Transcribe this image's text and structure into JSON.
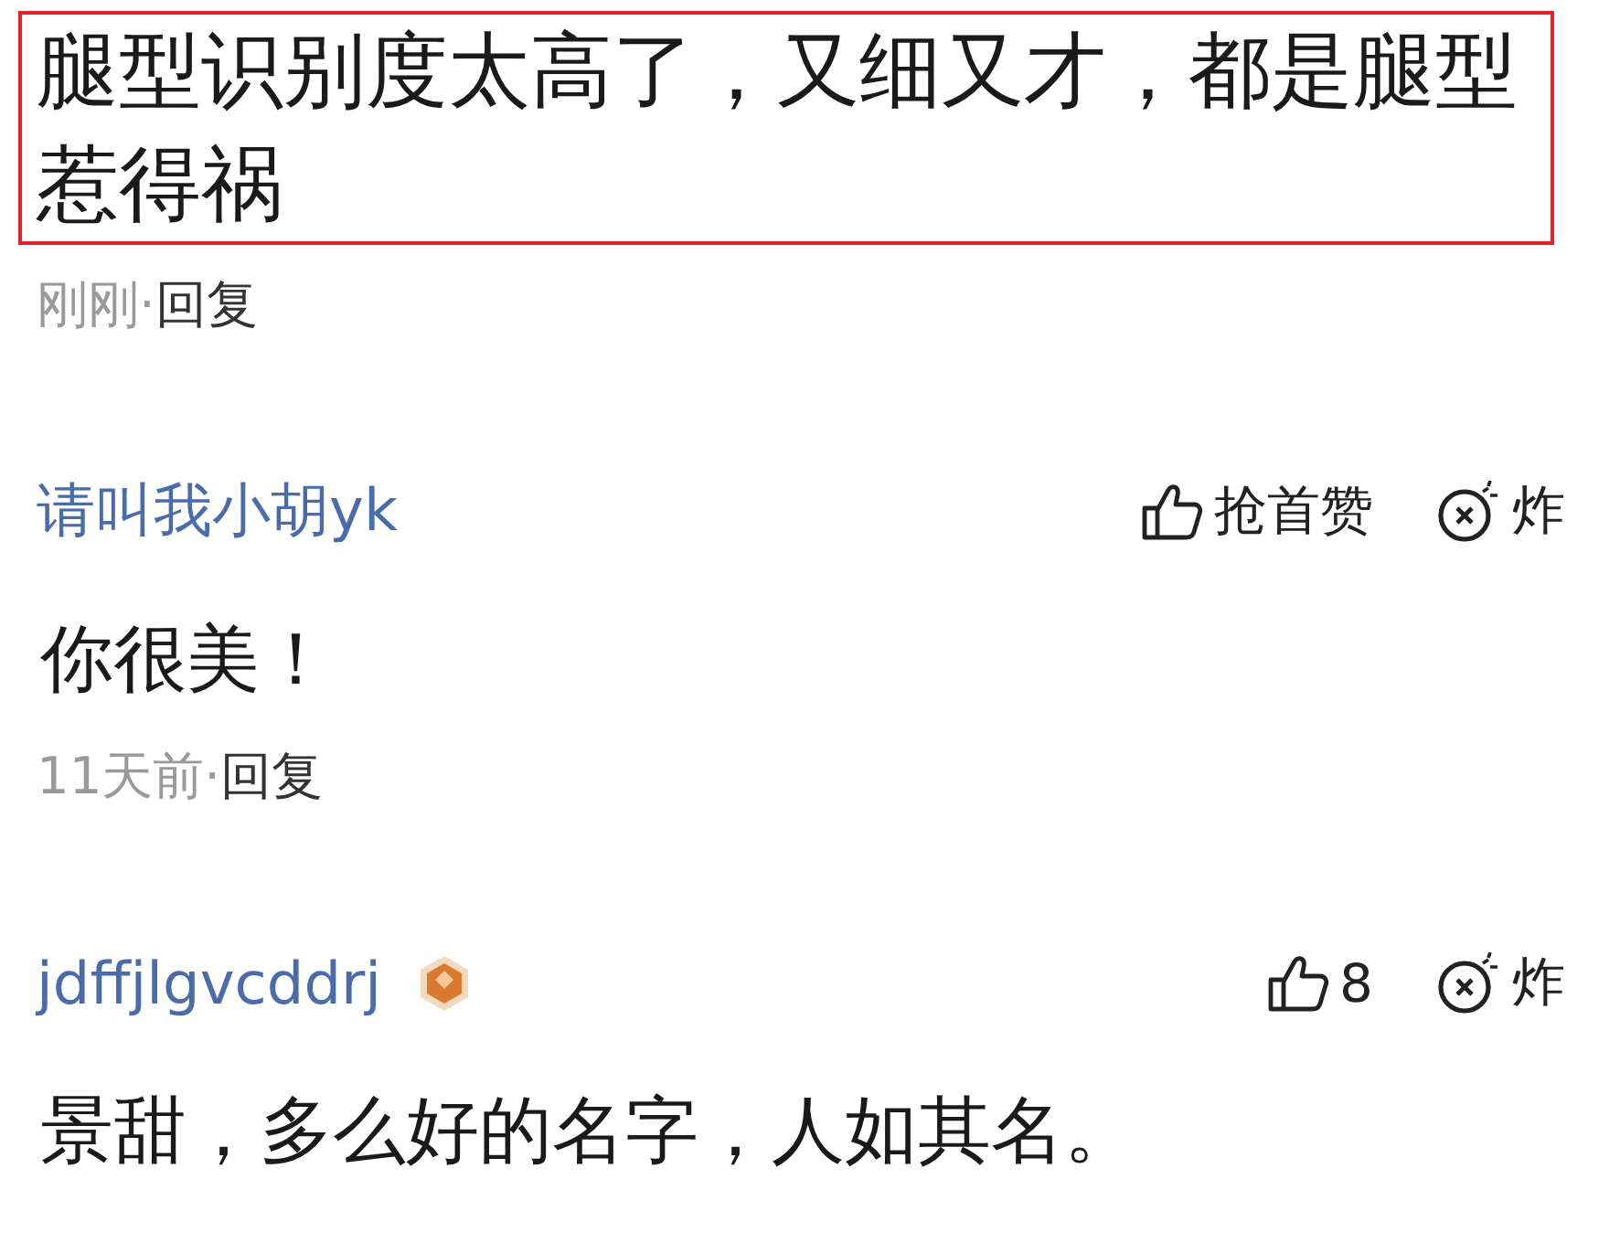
{
  "top_comment": {
    "text": "腿型识别度太高了，又细又才，都是腿型惹得祸",
    "highlighted": true,
    "time": "刚刚",
    "sep": "·",
    "reply": "回复"
  },
  "comments": [
    {
      "user": "请叫我小胡yk",
      "badge": false,
      "like": "抢首赞",
      "bomb": "炸",
      "text": "你很美！",
      "time": "11天前",
      "sep": "·",
      "reply": "回复"
    },
    {
      "user": "jdffjlgvcddrj",
      "badge": true,
      "like": "8",
      "bomb": "炸",
      "text": "景甜，多么好的名字，人如其名。"
    }
  ]
}
